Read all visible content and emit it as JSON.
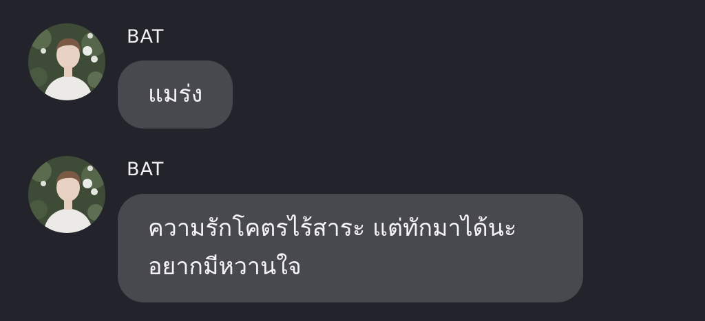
{
  "messages": [
    {
      "sender": "BAT",
      "avatar_icon": "profile-photo-avatar",
      "lines": [
        "แมร่ง"
      ]
    },
    {
      "sender": "BAT",
      "avatar_icon": "profile-photo-avatar",
      "lines": [
        "ความรักโคตรไร้สาระ แต่ทักมาได้นะ",
        "อยากมีหวานใจ"
      ]
    }
  ],
  "colors": {
    "background": "#23232b",
    "bubble": "#48484f",
    "text": "#f4f4f6"
  }
}
